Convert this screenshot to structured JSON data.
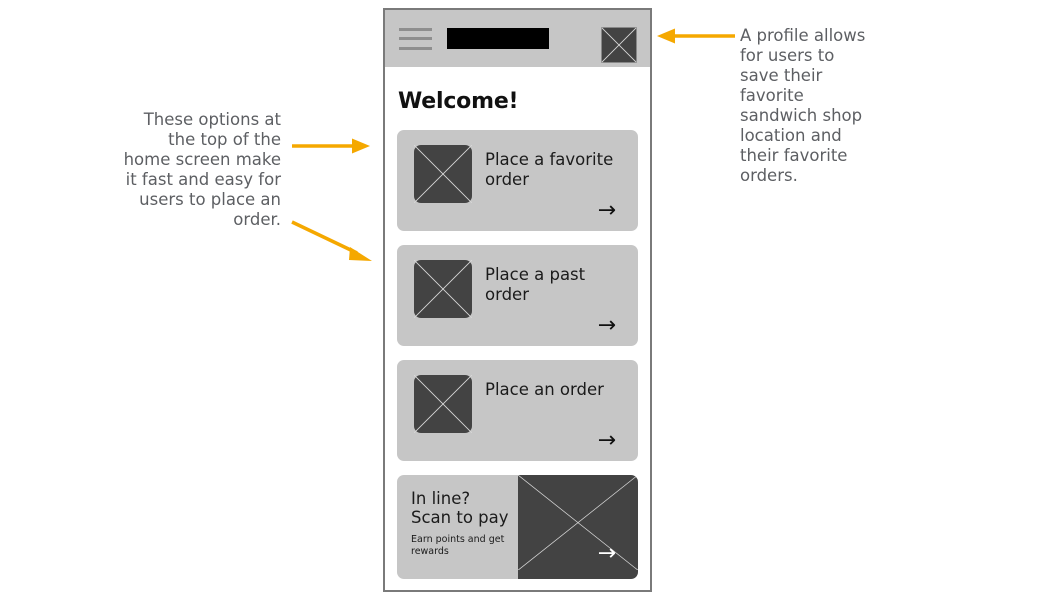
{
  "annotations": {
    "left": "These options at the top of the home screen make it fast and easy for users to place an order.",
    "right": "A profile allows for users to save their favorite sandwich shop location and their favorite orders.",
    "arrow_color": "#f5a800"
  },
  "phone": {
    "app_bar": {
      "menu_icon": "hamburger-menu-icon",
      "title_placeholder": "",
      "profile_icon": "profile-avatar-placeholder"
    },
    "heading": "Welcome!",
    "cards": [
      {
        "label": "Place a favorite order",
        "icon": "image-placeholder",
        "arrow": "→"
      },
      {
        "label": "Place a past order",
        "icon": "image-placeholder",
        "arrow": "→"
      },
      {
        "label": "Place an order",
        "icon": "image-placeholder",
        "arrow": "→"
      }
    ],
    "promo": {
      "line1": "In line?",
      "line2": "Scan to pay",
      "subtitle": "Earn points and get rewards",
      "arrow": "→",
      "image": "image-placeholder"
    }
  },
  "colors": {
    "card_bg": "#c6c6c6",
    "placeholder": "#434343",
    "frame_border": "#7a7a7a",
    "text": "#1b1b1b",
    "annotation_text": "#5d5f63"
  }
}
